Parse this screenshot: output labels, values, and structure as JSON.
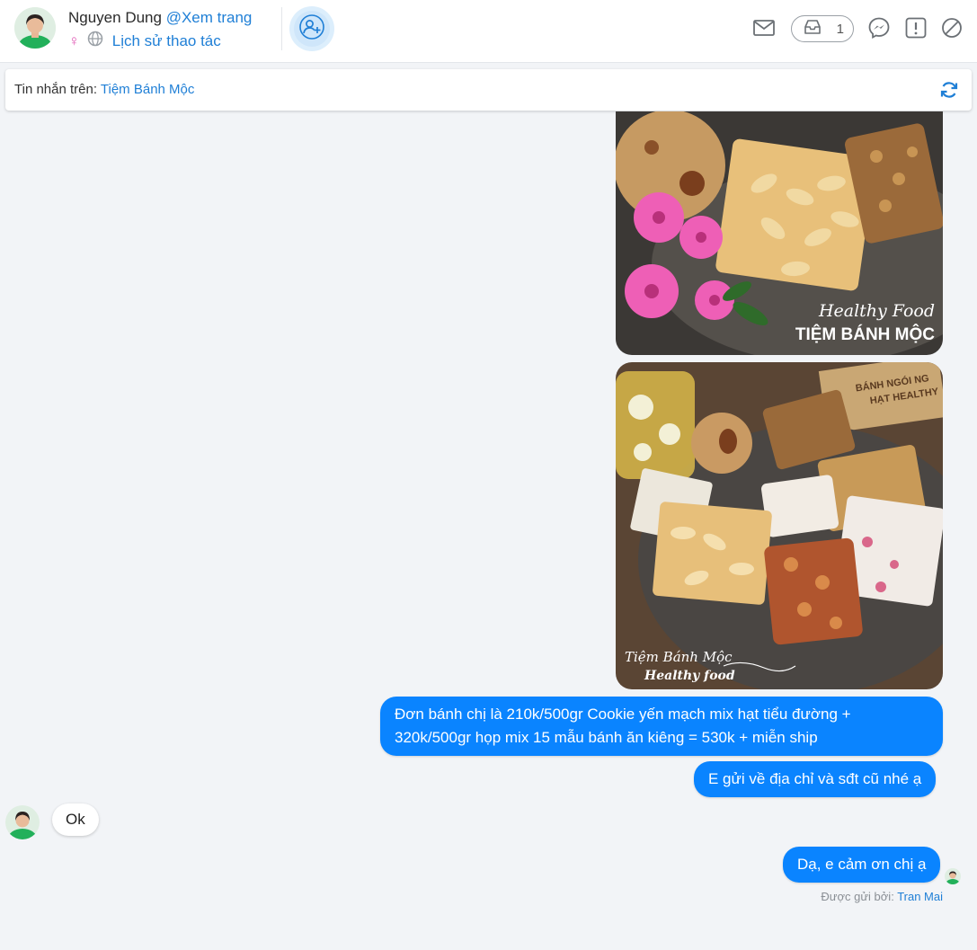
{
  "header": {
    "customer_name": "Nguyen Dung",
    "view_page_label": "@Xem trang",
    "gender_symbol": "♀",
    "history_label": "Lịch sử thao tác",
    "inbox_count": "1"
  },
  "source_bar": {
    "prefix": "Tin nhắn trên: ",
    "page_name": "Tiệm Bánh Mộc"
  },
  "images": {
    "photo1_watermark_script": "Healthy Food",
    "photo1_watermark_brand": "TIỆM BÁNH MỘC",
    "photo2_box_text_1": "BÁNH NGÓI NG",
    "photo2_box_text_2": "HẠT HEALTHY",
    "photo2_watermark_1": "Tiệm Bánh Mộc",
    "photo2_watermark_2": "Healthy food"
  },
  "messages": [
    {
      "direction": "outgoing",
      "text_line1": "Đơn bánh chị là 210k/500gr Cookie yến mạch mix hạt tiểu đường +",
      "text_line2": "320k/500gr họp mix 15 mẫu bánh ăn kiêng = 530k + miễn ship"
    },
    {
      "direction": "outgoing",
      "text": "E gửi về địa chỉ và sđt cũ nhé ạ"
    },
    {
      "direction": "incoming",
      "text": "Ok"
    },
    {
      "direction": "outgoing",
      "text": "Dạ, e cảm ơn chị ạ"
    }
  ],
  "sent_by": {
    "prefix": "Được gửi bởi: ",
    "agent": "Tran Mai"
  },
  "colors": {
    "accent": "#1f7fd6",
    "outgoing_bubble": "#0a84ff",
    "background": "#f2f4f7"
  },
  "icons": [
    "mail-icon",
    "inbox-icon",
    "messenger-icon",
    "report-icon",
    "block-icon",
    "refresh-icon",
    "add-user-icon",
    "globe-icon",
    "female-icon"
  ]
}
